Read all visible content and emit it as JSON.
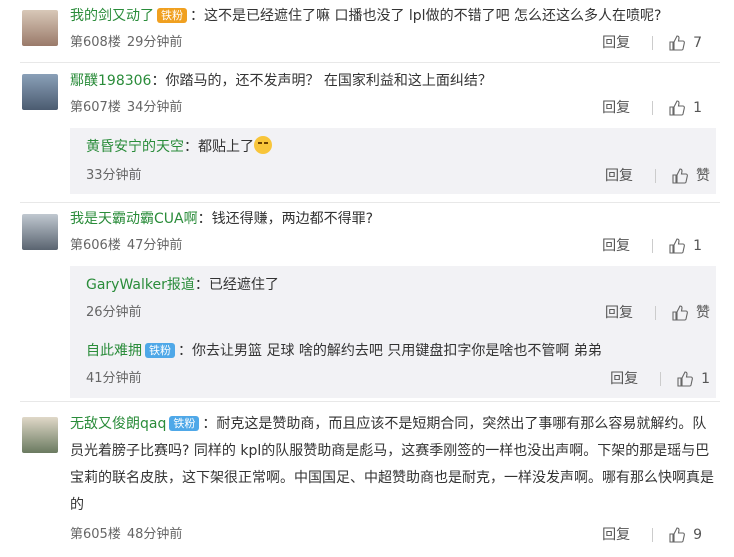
{
  "comments": [
    {
      "user": "我的剑又动了",
      "badge": "铁粉",
      "text": "：这不是已经遮住了嘛 口播也没了 lpl做的不错了吧 怎么还这么多人在喷呢?",
      "floor": "第608楼",
      "time": "29分钟前",
      "reply": "回复",
      "likes": "7"
    },
    {
      "user": "鄢醭198306",
      "text": "：你踏马的，还不发声明？ 在国家利益和这上面纠结？",
      "floor": "第607楼",
      "time": "34分钟前",
      "reply": "回复",
      "likes": "1",
      "subs": [
        {
          "user": "黄昏安宁的天空",
          "text": "：都贴上了",
          "time": "33分钟前",
          "reply": "回复",
          "likes": "赞"
        }
      ]
    },
    {
      "user": "我是天霸动霸CUA啊",
      "text": "：钱还得赚，两边都不得罪?",
      "floor": "第606楼",
      "time": "47分钟前",
      "reply": "回复",
      "likes": "1",
      "subs": [
        {
          "user": "GaryWalker报道",
          "text": "：已经遮住了",
          "time": "26分钟前",
          "reply": "回复",
          "likes": "赞"
        },
        {
          "user": "自此难拥",
          "badge": "铁粉",
          "text": "：你去让男篮 足球 啥的解约去吧 只用键盘扣字你是啥也不管啊 弟弟",
          "time": "41分钟前",
          "reply": "回复",
          "likes": "1"
        }
      ]
    },
    {
      "user": "无敌又俊朗qaq",
      "badge": "铁粉",
      "text": "：耐克这是赞助商，而且应该不是短期合同，突然出了事哪有那么容易就解约。队员光着膀子比赛吗? 同样的 kpl的队服赞助商是彪马，这赛季刚签的一样也没出声啊。下架的那是瑶与巴宝莉的联名皮肤，这下架很正常啊。中国国足、中超赞助商也是耐克，一样没发声啊。哪有那么快啊真是的",
      "floor": "第605楼",
      "time": "48分钟前",
      "reply": "回复",
      "likes": "9"
    }
  ],
  "colors": {
    "username": "#2a8c3a",
    "badge": "#4fa8e8",
    "subbox": "#f2f2f5"
  }
}
